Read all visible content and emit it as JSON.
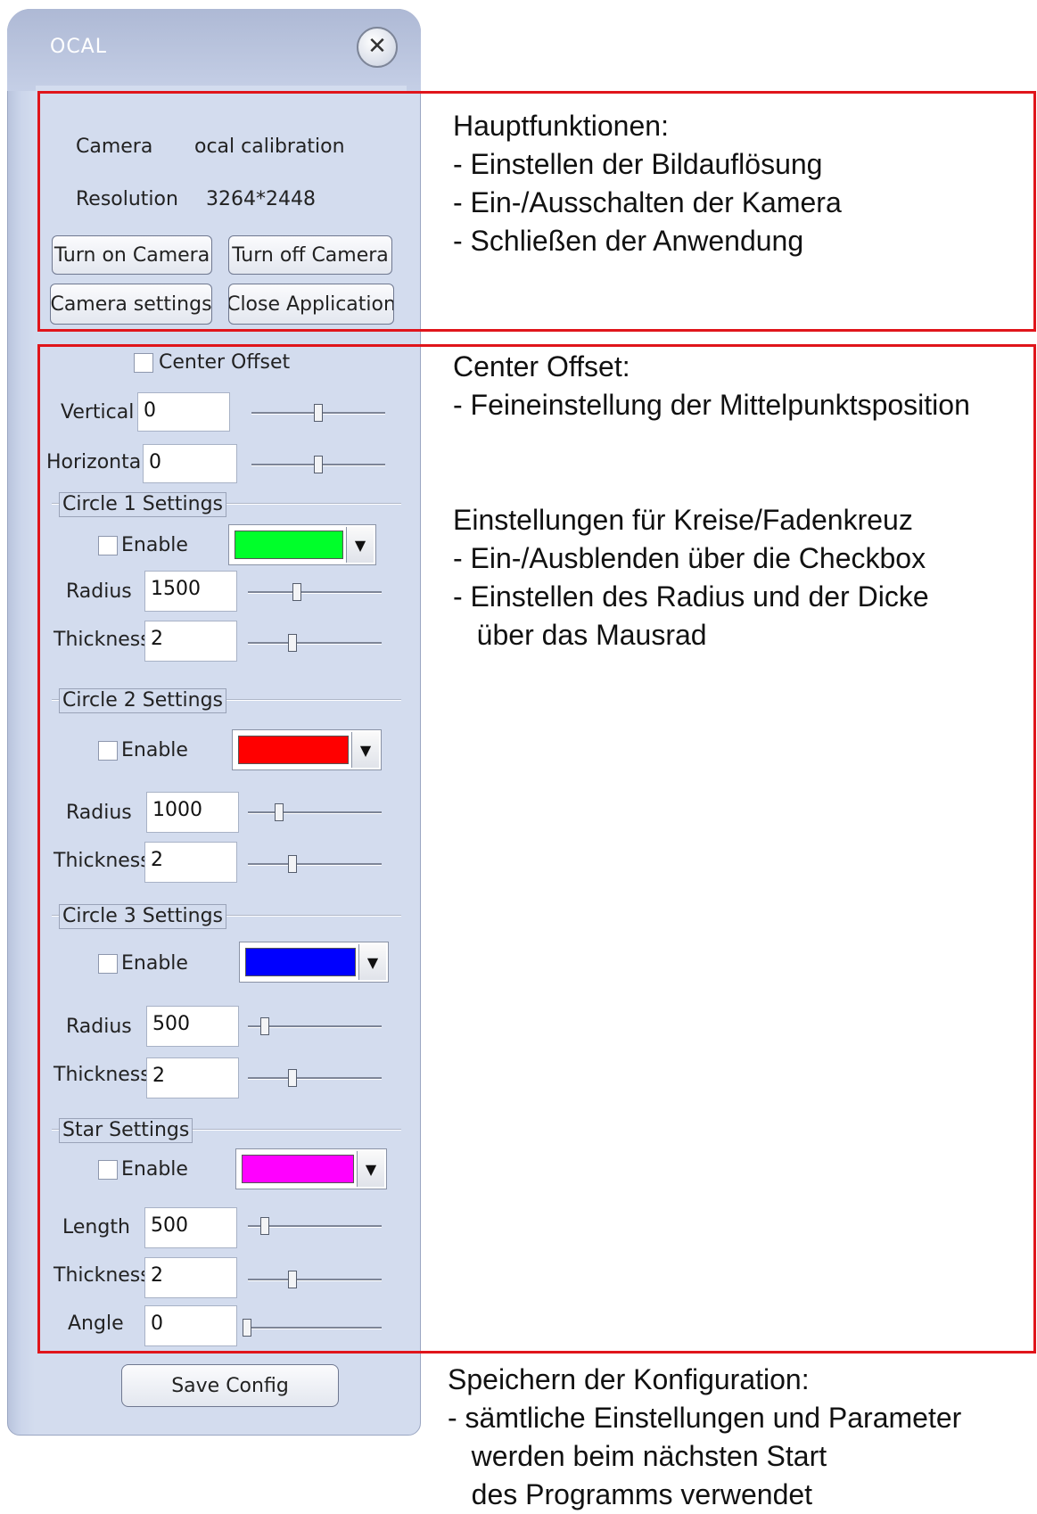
{
  "window": {
    "title": "OCAL"
  },
  "main": {
    "camera_label": "Camera",
    "camera_value": "ocal calibration",
    "resolution_label": "Resolution",
    "resolution_value": "3264*2448",
    "buttons": {
      "turn_on": "Turn on Camera",
      "turn_off": "Turn off Camera",
      "settings": "Camera settings",
      "close": "Close Application"
    }
  },
  "center_offset": {
    "checkbox_label": "Center Offset",
    "checked": false,
    "vertical_label": "Vertical",
    "vertical_value": "0",
    "horizontal_label": "Horizontal",
    "horizontal_value": "0"
  },
  "circle1": {
    "title": "Circle 1 Settings",
    "enable_label": "Enable",
    "color": "#00ff2a",
    "radius_label": "Radius",
    "radius_value": "1500",
    "thickness_label": "Thickness",
    "thickness_value": "2"
  },
  "circle2": {
    "title": "Circle 2 Settings",
    "enable_label": "Enable",
    "color": "#ff0000",
    "radius_label": "Radius",
    "radius_value": "1000",
    "thickness_label": "Thickness",
    "thickness_value": "2"
  },
  "circle3": {
    "title": "Circle 3 Settings",
    "enable_label": "Enable",
    "color": "#0000ff",
    "radius_label": "Radius",
    "radius_value": "500",
    "thickness_label": "Thickness",
    "thickness_value": "2"
  },
  "star": {
    "title": "Star Settings",
    "enable_label": "Enable",
    "color": "#ff00ff",
    "length_label": "Length",
    "length_value": "500",
    "thickness_label": "Thickness",
    "thickness_value": "2",
    "angle_label": "Angle",
    "angle_value": "0"
  },
  "save_button": "Save Config",
  "annotations": {
    "main_title": "Hauptfunktionen:",
    "main_items": [
      "- Einstellen der Bildauflösung",
      "- Ein-/Ausschalten der Kamera",
      "- Schließen der Anwendung"
    ],
    "offset_title": "Center Offset:",
    "offset_items": [
      "- Feineinstellung der Mittelpunktsposition"
    ],
    "circles_title": "Einstellungen für Kreise/Fadenkreuz",
    "circles_items": [
      "- Ein-/Ausblenden über die Checkbox",
      "- Einstellen des Radius und der Dicke",
      "   über das Mausrad"
    ],
    "save_title": "Speichern der Konfiguration:",
    "save_items": [
      "- sämtliche Einstellungen und Parameter",
      "   werden beim nächsten Start",
      "   des Programms verwendet"
    ]
  },
  "accent": {
    "annotation_box": "#e0151b",
    "window_bg": "#d3dcee"
  }
}
